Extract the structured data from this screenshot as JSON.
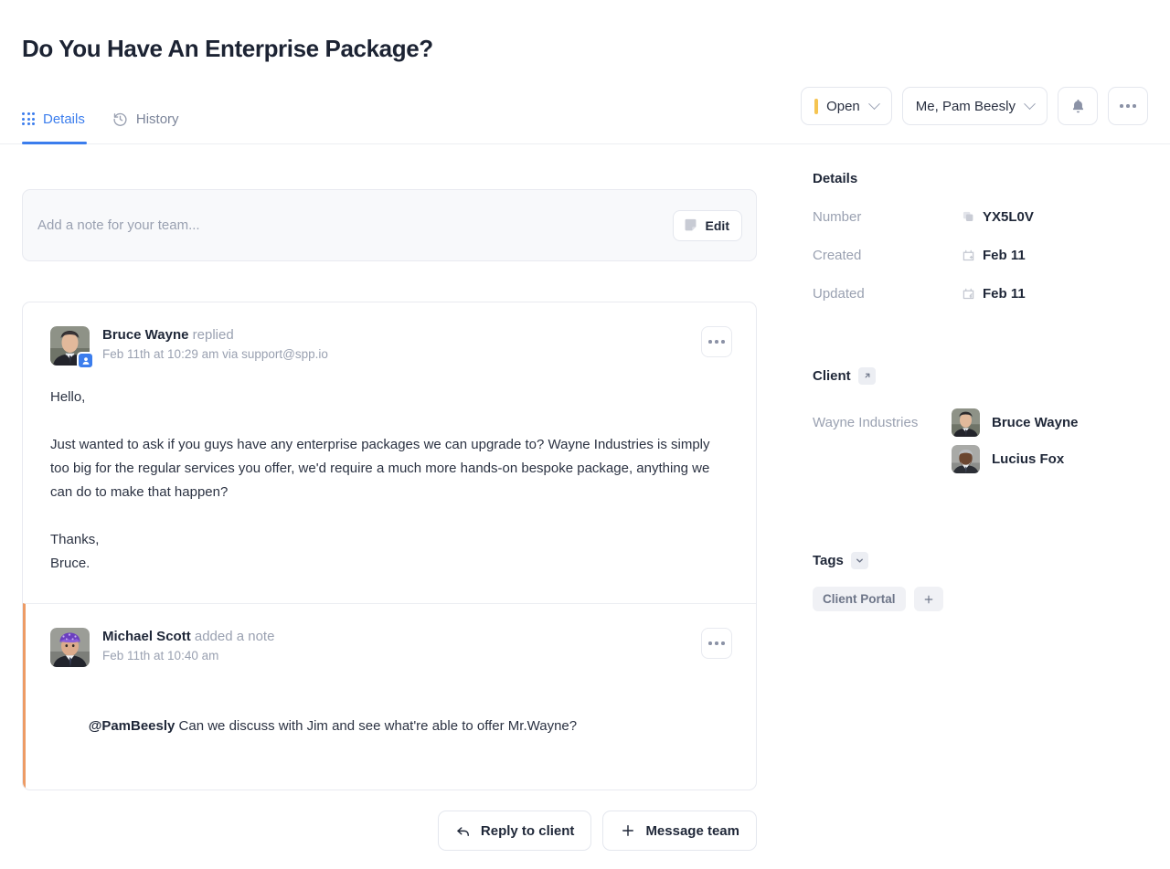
{
  "header": {
    "title": "Do You Have An Enterprise Package?",
    "tabs": [
      {
        "label": "Details",
        "icon": "grid-icon",
        "active": true
      },
      {
        "label": "History",
        "icon": "clock-rewind-icon",
        "active": false
      }
    ],
    "status": {
      "label": "Open",
      "color": "#f5c451"
    },
    "assignee": {
      "label": "Me, Pam Beesly"
    },
    "notification_icon": "bell-icon",
    "more_icon": "ellipsis-icon"
  },
  "composer": {
    "placeholder": "Add a note for your team...",
    "edit_label": "Edit",
    "edit_icon": "sticky-note-icon"
  },
  "thread": {
    "messages": [
      {
        "author": "Bruce Wayne",
        "action": "replied",
        "meta": "Feb 11th at 10:29 am via support@spp.io",
        "avatar": "bruce-wayne-avatar",
        "badge_icon": "client-user-icon",
        "type": "reply",
        "body": "Hello,\n\nJust wanted to ask if you guys have any enterprise packages we can upgrade to? Wayne Industries is simply too big for the regular services you offer, we'd require a much more hands-on bespoke package, anything we can do to make that happen?\n\nThanks,\nBruce."
      },
      {
        "author": "Michael Scott",
        "action": "added a note",
        "meta": "Feb 11th at 10:40 am",
        "avatar": "michael-scott-avatar",
        "type": "note",
        "accent": "#ed9b65",
        "body_mention": "@PamBeesly",
        "body_rest": " Can we discuss with Jim and see what're able to offer Mr.Wayne?"
      }
    ],
    "actions": [
      {
        "label": "Reply to client",
        "icon": "reply-arrow-icon"
      },
      {
        "label": "Message team",
        "icon": "plus-icon"
      }
    ]
  },
  "sidebar": {
    "details_title": "Details",
    "details_rows": [
      {
        "label": "Number",
        "value": "YX5L0V",
        "icon": "copy-icon"
      },
      {
        "label": "Created",
        "value": "Feb 11",
        "icon": "calendar-plus-icon"
      },
      {
        "label": "Updated",
        "value": "Feb 11",
        "icon": "calendar-edit-icon"
      }
    ],
    "client_title": "Client",
    "client_open_icon": "external-link-icon",
    "client_company": "Wayne Industries",
    "client_people": [
      {
        "name": "Bruce Wayne",
        "avatar": "bruce-wayne-avatar"
      },
      {
        "name": "Lucius Fox",
        "avatar": "lucius-fox-avatar"
      }
    ],
    "tags_title": "Tags",
    "tags_toggle_icon": "chevron-down-icon",
    "tags": [
      "Client Portal"
    ],
    "tag_add_icon": "plus-icon"
  }
}
